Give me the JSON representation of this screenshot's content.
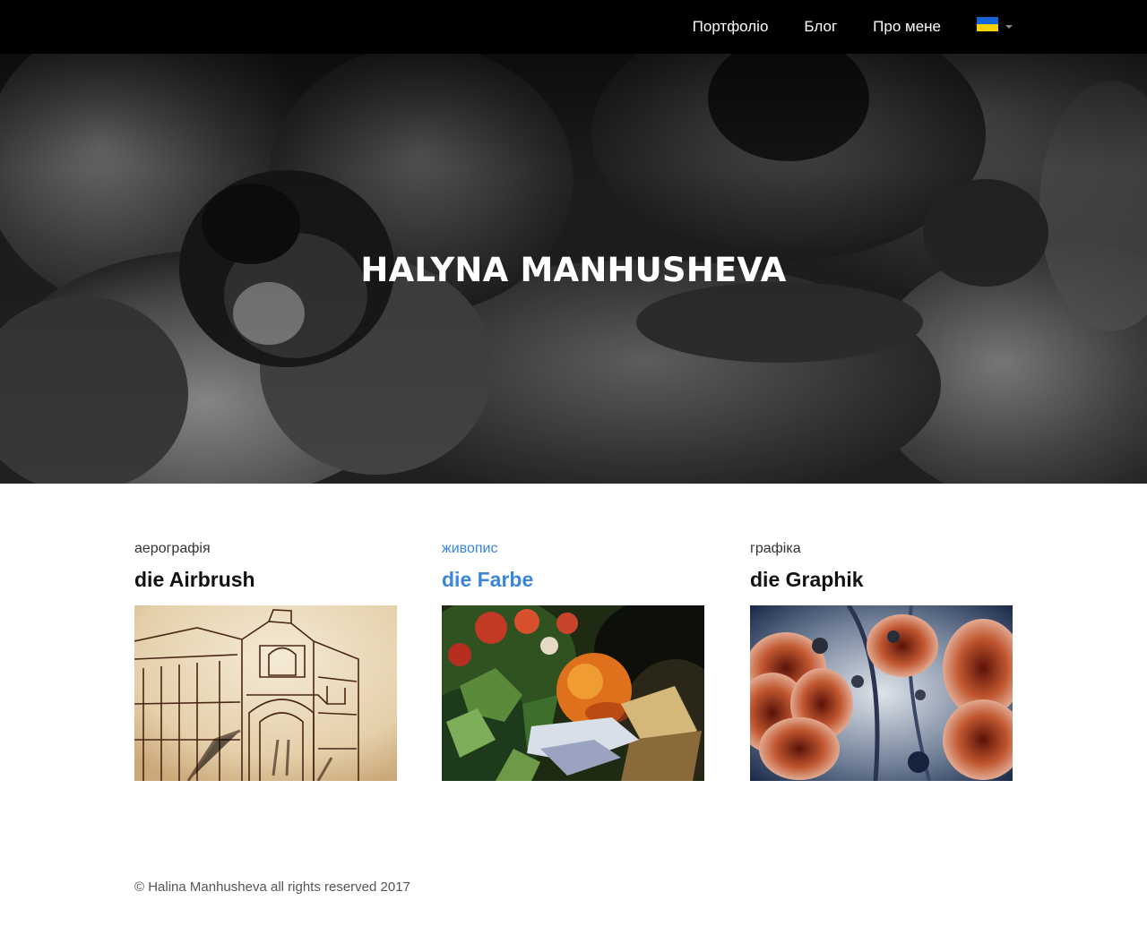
{
  "nav": {
    "items": [
      {
        "label": "Портфоліо"
      },
      {
        "label": "Блог"
      },
      {
        "label": "Про мене"
      }
    ],
    "language": {
      "flag_icon": "ukraine-flag-icon",
      "flag_colors": [
        "#1565d8",
        "#f7d000"
      ]
    }
  },
  "hero": {
    "title": "HALYNA MANHUSHEVA"
  },
  "categories": [
    {
      "subtitle": "аерографія",
      "title": "die Airbrush",
      "active": false
    },
    {
      "subtitle": "живопис",
      "title": "die Farbe",
      "active": true
    },
    {
      "subtitle": "графіка",
      "title": "die Graphik",
      "active": false
    }
  ],
  "footer": {
    "text": "© Halina Manhusheva all rights reserved 2017"
  },
  "colors": {
    "accent": "#3a86d9",
    "navbar": "#000000"
  }
}
